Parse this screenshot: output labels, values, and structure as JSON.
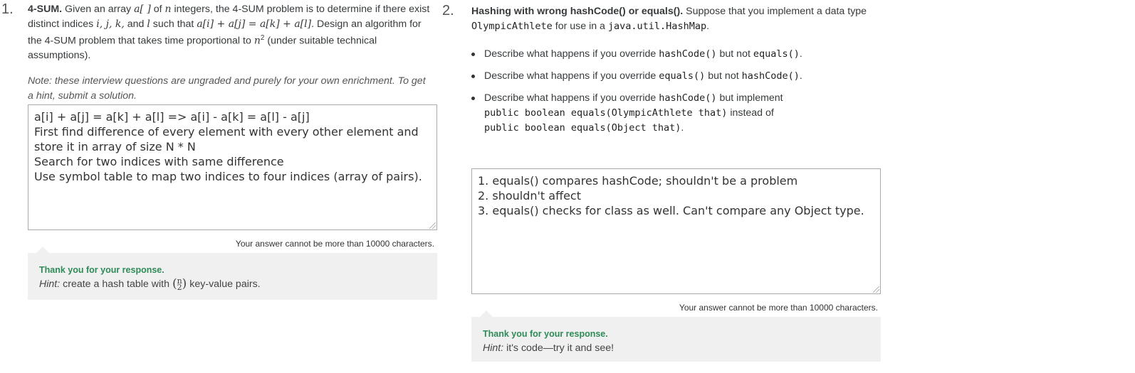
{
  "q1": {
    "number": "1.",
    "title": "4-SUM.",
    "text_1": "Given an array",
    "array_math": "a[ ]",
    "text_2": "of",
    "n_math": "n",
    "text_3": "integers, the 4-SUM problem is to determine if there exist distinct indices",
    "indices_math": "i, j, k,",
    "text_4": "and",
    "l_math": "l",
    "text_5": "such that",
    "eq_math": "a[i] + a[j] = a[k] + a[l]",
    "text_6": ". Design an algorithm for the 4-SUM problem that takes time proportional to",
    "n2_math": "n",
    "n2_exp": "2",
    "text_7": "(under suitable technical assumptions).",
    "note": "Note: these interview questions are ungraded and purely for your own enrichment. To get a hint, submit a solution.",
    "answer": "a[i] + a[j] = a[k] + a[l] => a[i] - a[k] = a[l] - a[j]\nFirst find difference of every element with every other element and store it in array of size N * N\nSearch for two indices with same difference\nUse symbol table to map two indices to four indices (array of pairs).",
    "char_limit": "Your answer cannot be more than 10000 characters.",
    "feedback_thanks": "Thank you for your response.",
    "hint_label": "Hint:",
    "hint_text_1": "create a hash table with",
    "hint_binom_top": "n",
    "hint_binom_bottom": "2",
    "hint_text_2": "key-value pairs."
  },
  "q2": {
    "number": "2.",
    "title": "Hashing with wrong hashCode() or equals().",
    "text_1": "Suppose that you implement a data type",
    "type_name": "OlympicAthlete",
    "text_2": "for use in a",
    "map_name": "java.util.HashMap",
    "text_3": ".",
    "bullets": [
      {
        "pre": "Describe what happens if you override",
        "code1": "hashCode()",
        "mid": "but not",
        "code2": "equals()",
        "post": "."
      },
      {
        "pre": "Describe what happens if you override",
        "code1": "equals()",
        "mid": "but not",
        "code2": "hashCode()",
        "post": "."
      }
    ],
    "bullet3_pre": "Describe what happens if you override",
    "bullet3_code1": "hashCode()",
    "bullet3_mid": "but implement",
    "bullet3_code2": "public boolean equals(OlympicAthlete that)",
    "bullet3_mid2": "instead of",
    "bullet3_code3": "public boolean equals(Object that)",
    "bullet3_post": ".",
    "answer": "1. equals() compares hashCode; shouldn't be a problem\n2. shouldn't affect\n3. equals() checks for class as well. Can't compare any Object type.",
    "char_limit": "Your answer cannot be more than 10000 characters.",
    "feedback_thanks": "Thank you for your response.",
    "hint_label": "Hint:",
    "hint_text": "it's code—try it and see!"
  }
}
